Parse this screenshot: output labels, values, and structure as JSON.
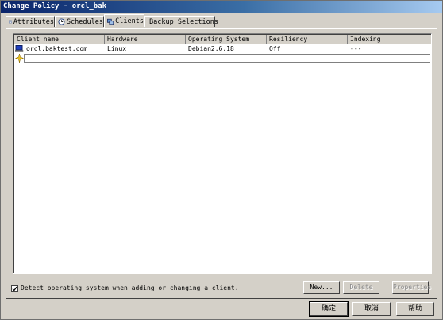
{
  "window": {
    "title": "Change Policy - orcl_bak"
  },
  "tabs": [
    {
      "label": "Attributes",
      "icon": "attributes-icon"
    },
    {
      "label": "Schedules",
      "icon": "schedules-icon"
    },
    {
      "label": "Clients",
      "icon": "clients-icon"
    },
    {
      "label": "Backup Selections",
      "icon": "folder-icon"
    }
  ],
  "active_tab": "Clients",
  "table": {
    "columns": [
      "Client name",
      "Hardware",
      "Operating System",
      "Resiliency",
      "Indexing"
    ],
    "rows": [
      {
        "client_name": "orcl.baktest.com",
        "hardware": "Linux",
        "os": "Debian2.6.18",
        "resiliency": "Off",
        "indexing": "---"
      }
    ]
  },
  "detect_os": {
    "label": "Detect operating system when adding or changing a client.",
    "checked": true
  },
  "buttons": {
    "new": "New...",
    "delete": "Delete",
    "properties": "Properties",
    "ok": "确定",
    "cancel": "取消",
    "help": "帮助"
  },
  "colors": {
    "title_start": "#0a246a",
    "title_end": "#a6caf0",
    "face": "#d4d0c8"
  }
}
